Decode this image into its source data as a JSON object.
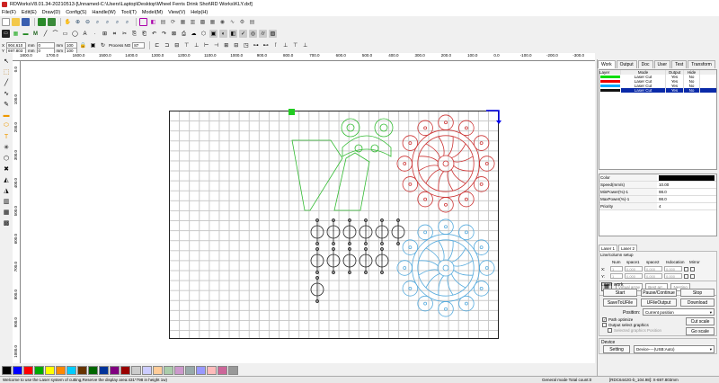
{
  "window": {
    "title": "RDWorksV8.01.34-20210513-[Unnamed-C:\\Users\\Laptop\\Desktop\\Wheel Ferris Drink Shot\\RD Works\\KLY.dxf]"
  },
  "menu": [
    "File(F)",
    "Edit(E)",
    "Draw(D)",
    "Config(S)",
    "Handle(W)",
    "Tool(T)",
    "Model(M)",
    "View(V)",
    "Help(H)"
  ],
  "toolbar": {
    "row1_icons": [
      "new-file-icon",
      "open-file-icon",
      "save-icon",
      "import-icon",
      "export-icon",
      "pan-icon",
      "zoom-in-icon",
      "zoom-out-icon",
      "zoom-page-icon",
      "zoom-select-icon",
      "zoom-window-icon",
      "zoom-data-icon",
      "frame-icon",
      "mirror-icon",
      "align-icon",
      "rotate-icon",
      "group-icon",
      "ungroup-icon",
      "grid-icon"
    ],
    "row3": {
      "x_label": "X",
      "x_value": "904.610",
      "y_label": "Y",
      "y_value": "697.803",
      "w_value": "0",
      "h_value": "0",
      "x_unit": "mm",
      "y_unit": "mm",
      "w_unit": "mm",
      "h_unit": "mm",
      "w_pct": "100",
      "h_pct": "100",
      "process_no": "Process NO",
      "process_no_value": "87"
    }
  },
  "ruler_h": [
    "1800.0",
    "1700.0",
    "1600.0",
    "1500.0",
    "1400.0",
    "1300.0",
    "1200.0",
    "1100.0",
    "1000.0",
    "900.0",
    "800.0",
    "700.0",
    "600.0",
    "500.0",
    "400.0",
    "300.0",
    "200.0",
    "100.0",
    "0.0",
    "-100.0",
    "-200.0",
    "-300.0"
  ],
  "ruler_v": [
    "0.0",
    "100.0",
    "200.0",
    "300.0",
    "400.0",
    "500.0",
    "600.0",
    "700.0",
    "800.0",
    "900.0",
    "1000.0"
  ],
  "palette": [
    "#000000",
    "#0000ff",
    "#ff0000",
    "#00aa00",
    "#ffff00",
    "#ff8800",
    "#00ccff",
    "#663300",
    "#006600",
    "#003399",
    "#800080",
    "#990000",
    "#cccccc",
    "#ccccff",
    "#ffcc99",
    "#aaccaa",
    "#cc99cc",
    "#99aaaa",
    "#9999ff",
    "#ffbbbb",
    "#cc6699",
    "#999999"
  ],
  "status": {
    "left": "Welcome to use the Laser system of cutting,Reserve the display area:431*798 in height 1w)",
    "mid": "General mode Total count:0",
    "right": "[RDC6442G-b_104.98]: X-697.803mm"
  },
  "right_panel": {
    "tabs": [
      "Work",
      "Output",
      "Doc",
      "User",
      "Test",
      "Transform"
    ],
    "layer_headers": [
      "Layer",
      "Mode",
      "Output",
      "Hide"
    ],
    "layers": [
      {
        "color": "#00dd00",
        "mode": "Laser Cut",
        "output": "Yes",
        "hide": "No"
      },
      {
        "color": "#ee0000",
        "mode": "Laser Cut",
        "output": "Yes",
        "hide": "No"
      },
      {
        "color": "#00aaff",
        "mode": "Laser Cut",
        "output": "Yes",
        "hide": "No"
      },
      {
        "color": "#111111",
        "mode": "Laser Cut",
        "output": "Yes",
        "hide": "No"
      }
    ],
    "props": [
      {
        "k": "Color",
        "v": ""
      },
      {
        "k": "Speed(mm/s)",
        "v": "10.00"
      },
      {
        "k": "MinPower(%)-1",
        "v": "98.0"
      },
      {
        "k": "MaxPower(%)-1",
        "v": "98.0"
      },
      {
        "k": "Priority",
        "v": "4"
      }
    ],
    "sub_tabs": [
      "Laser 1",
      "Laser 2"
    ],
    "array": {
      "title": "Line/column setup",
      "headers": [
        "Num",
        "space1",
        "space2",
        "Isdocation",
        "Mirror"
      ],
      "x_label": "X:",
      "y_label": "Y:",
      "x_vals": [
        "1",
        "0.000",
        "0.000",
        "0.000"
      ],
      "y_vals": [
        "1",
        "0.000",
        "0.000",
        "0.000"
      ],
      "buttons": [
        "Virtual array",
        "Best arr...",
        "Nesting"
      ]
    },
    "laser_work": {
      "title": "Laser work",
      "start": "Start",
      "pause": "Pause/Continue",
      "stop": "Stop",
      "save_file": "SaveToUFile",
      "ufile_output": "UFileOutput",
      "download": "Download",
      "position_label": "Position:",
      "position_value": "Current position",
      "path_optimize": "Path optimize",
      "output_select": "Output select graphics",
      "selected_only": "Selected graphics Position",
      "cut_scale": "Cut scale",
      "go_scale": "Go scale"
    },
    "device": {
      "title": "Device",
      "setting": "Setting",
      "value": "Device----(USB:Auto)"
    }
  }
}
